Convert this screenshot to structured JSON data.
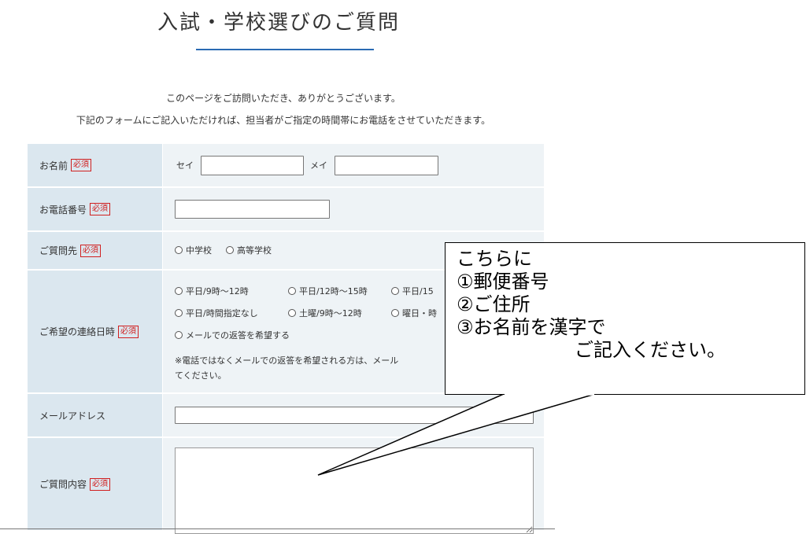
{
  "page": {
    "title": "入試・学校選びのご質問",
    "intro_line1": "このページをご訪問いただき、ありがとうございます。",
    "intro_line2": "下記のフォームにご記入いただければ、担当者がご指定の時間帯にお電話をさせていただきます。"
  },
  "form": {
    "required_mark": "必須",
    "name": {
      "label": "お名前",
      "sei_label": "セイ",
      "mei_label": "メイ",
      "sei_value": "",
      "mei_value": ""
    },
    "phone": {
      "label": "お電話番号",
      "value": ""
    },
    "inquiry_to": {
      "label": "ご質問先",
      "options": [
        "中学校",
        "高等学校"
      ]
    },
    "contact_time": {
      "label": "ご希望の連絡日時",
      "options": [
        "平日/9時～12時",
        "平日/12時～15時",
        "平日/15",
        "平日/時間指定なし",
        "土曜/9時～12時",
        "曜日・時",
        "メールでの返答を希望する"
      ],
      "note_line1": "※電話ではなくメールでの返答を希望される方は、メール",
      "note_line2": "てください。"
    },
    "email": {
      "label": "メールアドレス",
      "value": ""
    },
    "inquiry_content": {
      "label": "ご質問内容",
      "value": ""
    }
  },
  "callout": {
    "lines": [
      "こちらに",
      "①郵便番号",
      "②ご住所",
      "③お名前を漢字で",
      "ご記入ください。"
    ]
  }
}
